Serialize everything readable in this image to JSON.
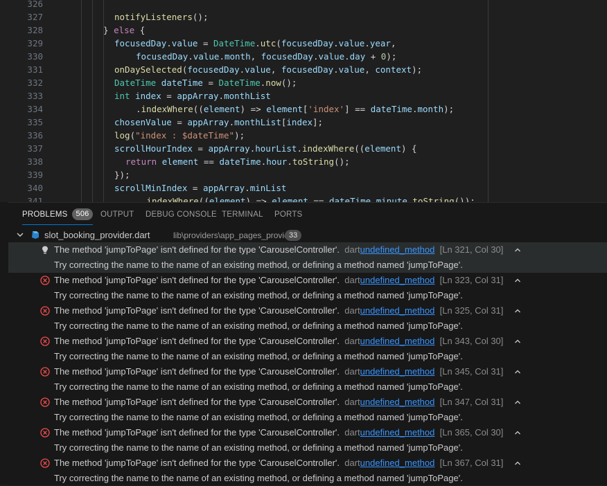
{
  "editor": {
    "lines": [
      {
        "num": "326",
        "indent": 0,
        "tokens": []
      },
      {
        "num": "327",
        "indent": 165,
        "tokens": [
          {
            "t": "notifyListeners",
            "c": "#dcdcaa"
          },
          {
            "t": "();",
            "c": "#d4d4d4"
          }
        ]
      },
      {
        "num": "328",
        "indent": 149,
        "tokens": [
          {
            "t": "} ",
            "c": "#d4d4d4"
          },
          {
            "t": "else",
            "c": "#c586c0"
          },
          {
            "t": " {",
            "c": "#d4d4d4"
          }
        ]
      },
      {
        "num": "329",
        "indent": 165,
        "tokens": [
          {
            "t": "focusedDay",
            "c": "#9cdcfe"
          },
          {
            "t": ".",
            "c": "#d4d4d4"
          },
          {
            "t": "value",
            "c": "#9cdcfe"
          },
          {
            "t": " = ",
            "c": "#d4d4d4"
          },
          {
            "t": "DateTime",
            "c": "#4ec9b0"
          },
          {
            "t": ".",
            "c": "#d4d4d4"
          },
          {
            "t": "utc",
            "c": "#dcdcaa"
          },
          {
            "t": "(",
            "c": "#d4d4d4"
          },
          {
            "t": "focusedDay",
            "c": "#9cdcfe"
          },
          {
            "t": ".",
            "c": "#d4d4d4"
          },
          {
            "t": "value",
            "c": "#9cdcfe"
          },
          {
            "t": ".",
            "c": "#d4d4d4"
          },
          {
            "t": "year",
            "c": "#9cdcfe"
          },
          {
            "t": ",",
            "c": "#d4d4d4"
          }
        ]
      },
      {
        "num": "330",
        "indent": 196,
        "tokens": [
          {
            "t": "focusedDay",
            "c": "#9cdcfe"
          },
          {
            "t": ".",
            "c": "#d4d4d4"
          },
          {
            "t": "value",
            "c": "#9cdcfe"
          },
          {
            "t": ".",
            "c": "#d4d4d4"
          },
          {
            "t": "month",
            "c": "#9cdcfe"
          },
          {
            "t": ", ",
            "c": "#d4d4d4"
          },
          {
            "t": "focusedDay",
            "c": "#9cdcfe"
          },
          {
            "t": ".",
            "c": "#d4d4d4"
          },
          {
            "t": "value",
            "c": "#9cdcfe"
          },
          {
            "t": ".",
            "c": "#d4d4d4"
          },
          {
            "t": "day",
            "c": "#9cdcfe"
          },
          {
            "t": " + ",
            "c": "#d4d4d4"
          },
          {
            "t": "0",
            "c": "#b5cea8"
          },
          {
            "t": ");",
            "c": "#d4d4d4"
          }
        ]
      },
      {
        "num": "331",
        "indent": 165,
        "tokens": [
          {
            "t": "onDaySelected",
            "c": "#dcdcaa"
          },
          {
            "t": "(",
            "c": "#d4d4d4"
          },
          {
            "t": "focusedDay",
            "c": "#9cdcfe"
          },
          {
            "t": ".",
            "c": "#d4d4d4"
          },
          {
            "t": "value",
            "c": "#9cdcfe"
          },
          {
            "t": ", ",
            "c": "#d4d4d4"
          },
          {
            "t": "focusedDay",
            "c": "#9cdcfe"
          },
          {
            "t": ".",
            "c": "#d4d4d4"
          },
          {
            "t": "value",
            "c": "#9cdcfe"
          },
          {
            "t": ", ",
            "c": "#d4d4d4"
          },
          {
            "t": "context",
            "c": "#9cdcfe"
          },
          {
            "t": ");",
            "c": "#d4d4d4"
          }
        ]
      },
      {
        "num": "332",
        "indent": 165,
        "tokens": [
          {
            "t": "DateTime",
            "c": "#4ec9b0"
          },
          {
            "t": " ",
            "c": "#d4d4d4"
          },
          {
            "t": "dateTime",
            "c": "#9cdcfe"
          },
          {
            "t": " = ",
            "c": "#d4d4d4"
          },
          {
            "t": "DateTime",
            "c": "#4ec9b0"
          },
          {
            "t": ".",
            "c": "#d4d4d4"
          },
          {
            "t": "now",
            "c": "#dcdcaa"
          },
          {
            "t": "();",
            "c": "#d4d4d4"
          }
        ]
      },
      {
        "num": "333",
        "indent": 165,
        "tokens": [
          {
            "t": "int",
            "c": "#4ec9b0"
          },
          {
            "t": " ",
            "c": "#d4d4d4"
          },
          {
            "t": "index",
            "c": "#9cdcfe"
          },
          {
            "t": " = ",
            "c": "#d4d4d4"
          },
          {
            "t": "appArray",
            "c": "#9cdcfe"
          },
          {
            "t": ".",
            "c": "#d4d4d4"
          },
          {
            "t": "monthList",
            "c": "#9cdcfe"
          }
        ]
      },
      {
        "num": "334",
        "indent": 196,
        "tokens": [
          {
            "t": ".",
            "c": "#d4d4d4"
          },
          {
            "t": "indexWhere",
            "c": "#dcdcaa"
          },
          {
            "t": "((",
            "c": "#d4d4d4"
          },
          {
            "t": "element",
            "c": "#9cdcfe"
          },
          {
            "t": ") => ",
            "c": "#d4d4d4"
          },
          {
            "t": "element",
            "c": "#9cdcfe"
          },
          {
            "t": "[",
            "c": "#d4d4d4"
          },
          {
            "t": "'index'",
            "c": "#ce9178"
          },
          {
            "t": "] == ",
            "c": "#d4d4d4"
          },
          {
            "t": "dateTime",
            "c": "#9cdcfe"
          },
          {
            "t": ".",
            "c": "#d4d4d4"
          },
          {
            "t": "month",
            "c": "#9cdcfe"
          },
          {
            "t": ");",
            "c": "#d4d4d4"
          }
        ]
      },
      {
        "num": "335",
        "indent": 165,
        "tokens": [
          {
            "t": "chosenValue",
            "c": "#9cdcfe"
          },
          {
            "t": " = ",
            "c": "#d4d4d4"
          },
          {
            "t": "appArray",
            "c": "#9cdcfe"
          },
          {
            "t": ".",
            "c": "#d4d4d4"
          },
          {
            "t": "monthList",
            "c": "#9cdcfe"
          },
          {
            "t": "[",
            "c": "#d4d4d4"
          },
          {
            "t": "index",
            "c": "#9cdcfe"
          },
          {
            "t": "];",
            "c": "#d4d4d4"
          }
        ]
      },
      {
        "num": "336",
        "indent": 165,
        "tokens": [
          {
            "t": "log",
            "c": "#dcdcaa"
          },
          {
            "t": "(",
            "c": "#d4d4d4"
          },
          {
            "t": "\"index : $dateTime\"",
            "c": "#ce9178"
          },
          {
            "t": ");",
            "c": "#d4d4d4"
          }
        ]
      },
      {
        "num": "337",
        "indent": 165,
        "tokens": [
          {
            "t": "scrollHourIndex",
            "c": "#9cdcfe"
          },
          {
            "t": " = ",
            "c": "#d4d4d4"
          },
          {
            "t": "appArray",
            "c": "#9cdcfe"
          },
          {
            "t": ".",
            "c": "#d4d4d4"
          },
          {
            "t": "hourList",
            "c": "#9cdcfe"
          },
          {
            "t": ".",
            "c": "#d4d4d4"
          },
          {
            "t": "indexWhere",
            "c": "#dcdcaa"
          },
          {
            "t": "((",
            "c": "#d4d4d4"
          },
          {
            "t": "element",
            "c": "#9cdcfe"
          },
          {
            "t": ") {",
            "c": "#d4d4d4"
          }
        ]
      },
      {
        "num": "338",
        "indent": 181,
        "tokens": [
          {
            "t": "return",
            "c": "#c586c0"
          },
          {
            "t": " ",
            "c": "#d4d4d4"
          },
          {
            "t": "element",
            "c": "#9cdcfe"
          },
          {
            "t": " == ",
            "c": "#d4d4d4"
          },
          {
            "t": "dateTime",
            "c": "#9cdcfe"
          },
          {
            "t": ".",
            "c": "#d4d4d4"
          },
          {
            "t": "hour",
            "c": "#9cdcfe"
          },
          {
            "t": ".",
            "c": "#d4d4d4"
          },
          {
            "t": "toString",
            "c": "#dcdcaa"
          },
          {
            "t": "();",
            "c": "#d4d4d4"
          }
        ]
      },
      {
        "num": "339",
        "indent": 165,
        "tokens": [
          {
            "t": "});",
            "c": "#d4d4d4"
          }
        ]
      },
      {
        "num": "340",
        "indent": 165,
        "tokens": [
          {
            "t": "scrollMinIndex",
            "c": "#9cdcfe"
          },
          {
            "t": " = ",
            "c": "#d4d4d4"
          },
          {
            "t": "appArray",
            "c": "#9cdcfe"
          },
          {
            "t": ".",
            "c": "#d4d4d4"
          },
          {
            "t": "minList",
            "c": "#9cdcfe"
          }
        ]
      },
      {
        "num": "341",
        "indent": 204,
        "tokens": [
          {
            "t": ".",
            "c": "#d4d4d4"
          },
          {
            "t": "indexWhere",
            "c": "#dcdcaa"
          },
          {
            "t": "((",
            "c": "#d4d4d4"
          },
          {
            "t": "element",
            "c": "#9cdcfe"
          },
          {
            "t": ") => ",
            "c": "#d4d4d4"
          },
          {
            "t": "element",
            "c": "#9cdcfe"
          },
          {
            "t": " == ",
            "c": "#d4d4d4"
          },
          {
            "t": "dateTime",
            "c": "#9cdcfe"
          },
          {
            "t": ".",
            "c": "#d4d4d4"
          },
          {
            "t": "minute",
            "c": "#9cdcfe"
          },
          {
            "t": ".",
            "c": "#d4d4d4"
          },
          {
            "t": "toString",
            "c": "#dcdcaa"
          },
          {
            "t": "());",
            "c": "#d4d4d4"
          }
        ]
      }
    ]
  },
  "panel": {
    "tabs": [
      {
        "id": "problems",
        "label": "PROBLEMS",
        "badge": "506",
        "active": true
      },
      {
        "id": "output",
        "label": "OUTPUT"
      },
      {
        "id": "debug",
        "label": "DEBUG CONSOLE"
      },
      {
        "id": "terminal",
        "label": "TERMINAL"
      },
      {
        "id": "ports",
        "label": "PORTS"
      }
    ],
    "file": {
      "name": "slot_booking_provider.dart",
      "path": "lib\\providers\\app_pages_providers",
      "count": "33",
      "chevron_icon": "chevron-down-icon",
      "file_icon": "dart-file-icon"
    },
    "problems": [
      {
        "severity": "info",
        "icon": "lightbulb-icon",
        "message": "The method 'jumpToPage' isn't defined for the type 'CarouselController'.",
        "source": "dart",
        "code": "undefined_method",
        "location": "[Ln 321, Col 30]",
        "hint": "Try correcting the name to the name of an existing method, or defining a method named 'jumpToPage'.",
        "selected": true
      },
      {
        "severity": "error",
        "icon": "error-icon",
        "message": "The method 'jumpToPage' isn't defined for the type 'CarouselController'.",
        "source": "dart",
        "code": "undefined_method",
        "location": "[Ln 323, Col 31]",
        "hint": "Try correcting the name to the name of an existing method, or defining a method named 'jumpToPage'."
      },
      {
        "severity": "error",
        "icon": "error-icon",
        "message": "The method 'jumpToPage' isn't defined for the type 'CarouselController'.",
        "source": "dart",
        "code": "undefined_method",
        "location": "[Ln 325, Col 31]",
        "hint": "Try correcting the name to the name of an existing method, or defining a method named 'jumpToPage'."
      },
      {
        "severity": "error",
        "icon": "error-icon",
        "message": "The method 'jumpToPage' isn't defined for the type 'CarouselController'.",
        "source": "dart",
        "code": "undefined_method",
        "location": "[Ln 343, Col 30]",
        "hint": "Try correcting the name to the name of an existing method, or defining a method named 'jumpToPage'."
      },
      {
        "severity": "error",
        "icon": "error-icon",
        "message": "The method 'jumpToPage' isn't defined for the type 'CarouselController'.",
        "source": "dart",
        "code": "undefined_method",
        "location": "[Ln 345, Col 31]",
        "hint": "Try correcting the name to the name of an existing method, or defining a method named 'jumpToPage'."
      },
      {
        "severity": "error",
        "icon": "error-icon",
        "message": "The method 'jumpToPage' isn't defined for the type 'CarouselController'.",
        "source": "dart",
        "code": "undefined_method",
        "location": "[Ln 347, Col 31]",
        "hint": "Try correcting the name to the name of an existing method, or defining a method named 'jumpToPage'."
      },
      {
        "severity": "error",
        "icon": "error-icon",
        "message": "The method 'jumpToPage' isn't defined for the type 'CarouselController'.",
        "source": "dart",
        "code": "undefined_method",
        "location": "[Ln 365, Col 30]",
        "hint": "Try correcting the name to the name of an existing method, or defining a method named 'jumpToPage'."
      },
      {
        "severity": "error",
        "icon": "error-icon",
        "message": "The method 'jumpToPage' isn't defined for the type 'CarouselController'.",
        "source": "dart",
        "code": "undefined_method",
        "location": "[Ln 367, Col 31]",
        "hint": "Try correcting the name to the name of an existing method, or defining a method named 'jumpToPage'."
      }
    ],
    "colors": {
      "accent": "#0078d4",
      "error": "#f14c4c",
      "info": "#cccccc",
      "link": "#3794ff"
    }
  }
}
